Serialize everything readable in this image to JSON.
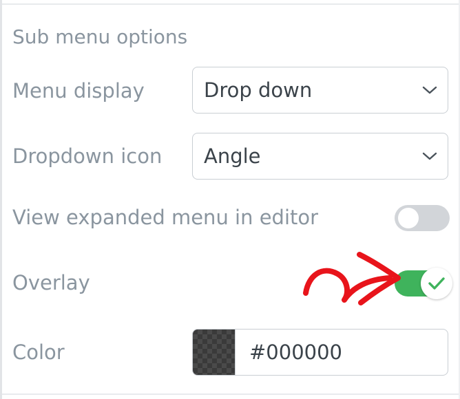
{
  "section": {
    "title": "Sub menu options"
  },
  "menu_display": {
    "label": "Menu display",
    "value": "Drop down"
  },
  "dropdown_icon": {
    "label": "Dropdown icon",
    "value": "Angle"
  },
  "view_expanded": {
    "label": "View expanded menu in editor",
    "enabled": false
  },
  "overlay": {
    "label": "Overlay",
    "enabled": true
  },
  "color": {
    "label": "Color",
    "value": "#000000",
    "swatch": "#000000"
  },
  "colors": {
    "label_text": "#8a959f",
    "toggle_on": "#3fb35c",
    "toggle_off": "#d2d5d9",
    "annotation_arrow": "#e8141b"
  },
  "icons": {
    "select_chevron": "chevron-down-icon",
    "toggle_check": "check-icon",
    "annotation": "red-arrow-annotation"
  }
}
